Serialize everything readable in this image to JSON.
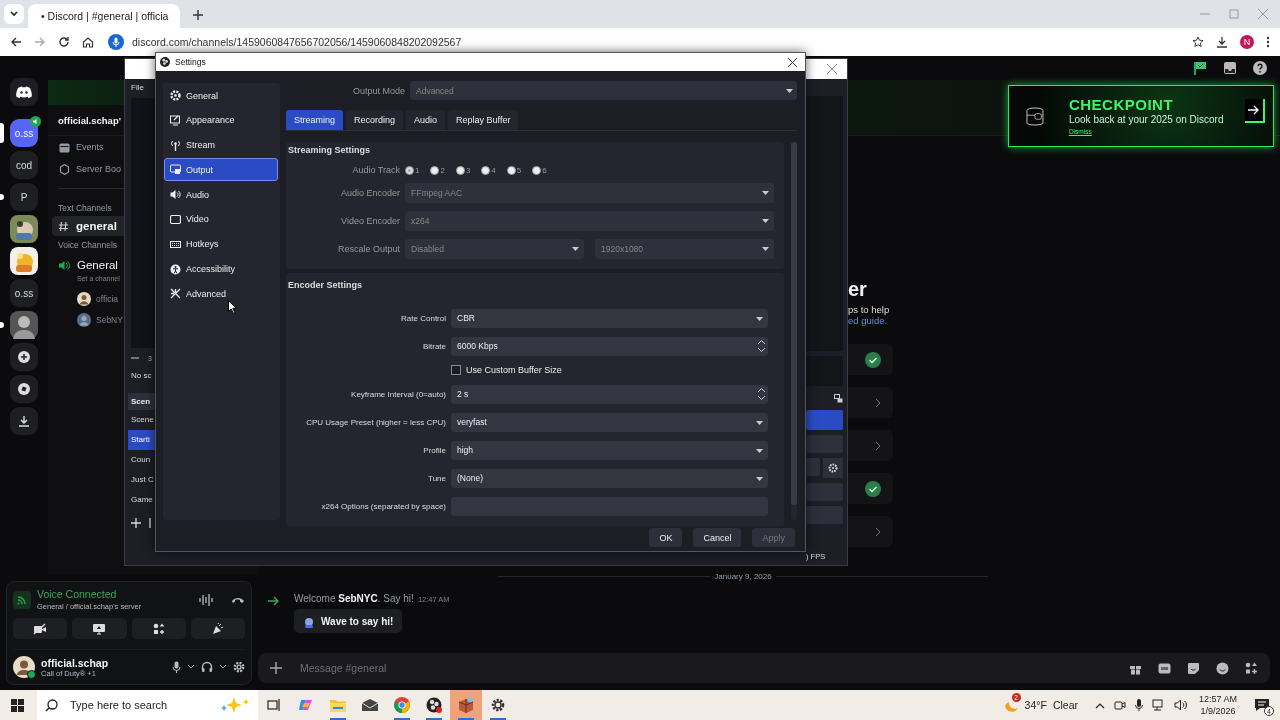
{
  "browser": {
    "tab_title": "• Discord | #general | officia",
    "url": "discord.com/channels/1459060847656702056/1459060848202092567",
    "profile_initial": "N"
  },
  "discord": {
    "servers": [
      {
        "kind": "logo",
        "selected": false,
        "unread": false
      },
      {
        "kind": "text",
        "label": "o.ss",
        "selected": true,
        "unread": false,
        "voice": true
      },
      {
        "kind": "text",
        "label": "cod",
        "selected": false,
        "unread": false,
        "voice": false
      },
      {
        "kind": "text",
        "label": "P",
        "selected": false,
        "unread": true,
        "voice": false
      },
      {
        "kind": "picture",
        "selected": false,
        "unread": false
      },
      {
        "kind": "picture",
        "selected": false,
        "unread": false
      },
      {
        "kind": "text",
        "label": "o.ss",
        "selected": false,
        "unread": false,
        "voice": false
      },
      {
        "kind": "person",
        "selected": false,
        "unread": true
      },
      {
        "kind": "add",
        "selected": false,
        "unread": false
      },
      {
        "kind": "explore",
        "selected": false,
        "unread": false
      },
      {
        "kind": "download",
        "selected": false,
        "unread": false
      }
    ],
    "server_name": "official.schap'",
    "menu": [
      {
        "kind": "events",
        "label": "Events"
      },
      {
        "kind": "boost",
        "label": "Server Boo"
      }
    ],
    "text_category": "Text Channels",
    "text_channels": [
      {
        "name": "general",
        "selected": true
      }
    ],
    "voice_category": "Voice Channels",
    "voice_channels": [
      {
        "name": "General",
        "status": "Set a channel",
        "members": [
          "officia",
          "SebNY"
        ]
      }
    ],
    "voice_panel": {
      "status": "Voice Connected",
      "location": "General / official.schap's server"
    },
    "user": {
      "name": "official.schap",
      "activity": "Call of Duty® +1",
      "online": true
    },
    "onboarding": {
      "heading": "er",
      "text": "ps to help",
      "link": "ed guide.",
      "steps": [
        {
          "done": true
        },
        {
          "done": false
        },
        {
          "done": false
        },
        {
          "done": true
        },
        {
          "done": false
        }
      ]
    },
    "date_divider": "January 9, 2026",
    "message": {
      "text": "Welcome **SebNYC**. Say hi!",
      "time": "12:47 AM",
      "button": "Wave to say hi!"
    },
    "composer": {
      "placeholder": "Message #general"
    },
    "banner": {
      "title": "CHECKPOINT",
      "text": "Look back at your 2025 on Discord",
      "link": "Dismiss"
    }
  },
  "obs": {
    "menu": [
      "File"
    ],
    "dock_fragment": "3",
    "sources_fragment": "No sc",
    "scenes_header": "Scen",
    "scenes": [
      {
        "name": "Scene",
        "selected": false
      },
      {
        "name": "Starti",
        "selected": true
      },
      {
        "name": "Coun",
        "selected": false
      },
      {
        "name": "Just C",
        "selected": false
      },
      {
        "name": "Game",
        "selected": false
      }
    ],
    "status_fragment": ") FPS"
  },
  "settings": {
    "title": "Settings",
    "nav": [
      {
        "kind": "general",
        "label": "General",
        "selected": false
      },
      {
        "kind": "appearance",
        "label": "Appearance",
        "selected": false
      },
      {
        "kind": "stream",
        "label": "Stream",
        "selected": false
      },
      {
        "kind": "output",
        "label": "Output",
        "selected": true
      },
      {
        "kind": "audio",
        "label": "Audio",
        "selected": false
      },
      {
        "kind": "video",
        "label": "Video",
        "selected": false
      },
      {
        "kind": "hotkeys",
        "label": "Hotkeys",
        "selected": false
      },
      {
        "kind": "accessibility",
        "label": "Accessibility",
        "selected": false
      },
      {
        "kind": "advanced",
        "label": "Advanced",
        "selected": false
      }
    ],
    "output_mode": {
      "label": "Output Mode",
      "value": "Advanced",
      "disabled": true
    },
    "tabs": [
      {
        "label": "Streaming",
        "selected": true
      },
      {
        "label": "Recording",
        "selected": false
      },
      {
        "label": "Audio",
        "selected": false
      },
      {
        "label": "Replay Buffer",
        "selected": false
      }
    ],
    "streaming": {
      "title": "Streaming Settings",
      "audio_track_label": "Audio Track",
      "tracks": [
        {
          "label": "1",
          "checked": true
        },
        {
          "label": "2",
          "checked": false
        },
        {
          "label": "3",
          "checked": false
        },
        {
          "label": "4",
          "checked": false
        },
        {
          "label": "5",
          "checked": false
        },
        {
          "label": "6",
          "checked": false
        }
      ],
      "fields": [
        {
          "label": "Audio Encoder",
          "values": [
            "FFmpeg AAC"
          ],
          "disabled": true
        },
        {
          "label": "Video Encoder",
          "values": [
            "x264"
          ],
          "disabled": true
        },
        {
          "label": "Rescale Output",
          "values": [
            "Disabled",
            "1920x1080"
          ],
          "disabled": true
        }
      ]
    },
    "encoder": {
      "title": "Encoder Settings",
      "fields": [
        {
          "kind": "dropdown",
          "label": "Rate Control",
          "value": "CBR"
        },
        {
          "kind": "spin",
          "label": "Bitrate",
          "value": "6000 Kbps"
        },
        {
          "kind": "checkbox",
          "label": "Use Custom Buffer Size",
          "checked": false
        },
        {
          "kind": "spin",
          "label": "Keyframe Interval (0=auto)",
          "value": "2 s"
        },
        {
          "kind": "dropdown",
          "label": "CPU Usage Preset (higher = less CPU)",
          "value": "veryfast"
        },
        {
          "kind": "dropdown",
          "label": "Profile",
          "value": "high"
        },
        {
          "kind": "dropdown",
          "label": "Tune",
          "value": "(None)"
        },
        {
          "kind": "text",
          "label": "x264 Options (separated by space)"
        }
      ]
    },
    "buttons": [
      {
        "label": "OK",
        "disabled": false
      },
      {
        "label": "Cancel",
        "disabled": false
      },
      {
        "label": "Apply",
        "disabled": true
      }
    ]
  },
  "taskbar": {
    "search_placeholder": "Type here to search",
    "apps": [
      {
        "kind": "taskview",
        "running": false,
        "selected": false
      },
      {
        "kind": "copilot",
        "running": false,
        "selected": false
      },
      {
        "kind": "files",
        "running": true,
        "selected": false
      },
      {
        "kind": "mail",
        "running": false,
        "selected": false
      },
      {
        "kind": "chrome",
        "running": true,
        "selected": false
      },
      {
        "kind": "obs",
        "running": true,
        "selected": false
      },
      {
        "kind": "package",
        "running": true,
        "selected": true
      },
      {
        "kind": "settings",
        "running": true,
        "selected": false
      }
    ],
    "weather": {
      "temp": "34°F",
      "condition": "Clear",
      "badge": "2"
    },
    "time": "12:57 AM",
    "date": "1/9/2026",
    "notifications": "4"
  }
}
